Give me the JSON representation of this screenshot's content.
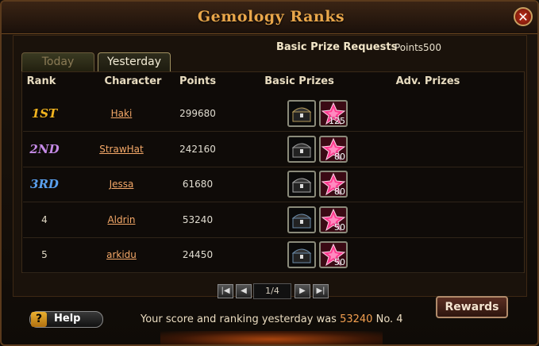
{
  "window": {
    "title": "Gemology Ranks",
    "close_icon": "✕"
  },
  "prize_requests": {
    "label": "Basic Prize Requests",
    "points_text": "Points500"
  },
  "tabs": [
    {
      "label": "Today",
      "active": false
    },
    {
      "label": "Yesterday",
      "active": true
    }
  ],
  "columns": {
    "rank": "Rank",
    "character": "Character",
    "points": "Points",
    "basic_prizes": "Basic Prizes",
    "adv_prizes": "Adv. Prizes"
  },
  "rows": [
    {
      "rank": "1ST",
      "rank_color": "#f3b51f",
      "character": "Haki",
      "points": "299680",
      "chest_color": "#b59a5a",
      "gem_qty": "125"
    },
    {
      "rank": "2ND",
      "rank_color": "#c58ae6",
      "character": "StrawHat",
      "points": "242160",
      "chest_color": "#9a9a9a",
      "gem_qty": "80"
    },
    {
      "rank": "3RD",
      "rank_color": "#5aa0ee",
      "character": "Jessa",
      "points": "61680",
      "chest_color": "#a5a5a5",
      "gem_qty": "80"
    },
    {
      "rank": "4",
      "rank_color": "#e0d8c4",
      "character": "Aldrin",
      "points": "53240",
      "chest_color": "#6a8aa8",
      "gem_qty": "50"
    },
    {
      "rank": "5",
      "rank_color": "#e0d8c4",
      "character": "arkidu",
      "points": "24450",
      "chest_color": "#6a8aa8",
      "gem_qty": "50"
    }
  ],
  "pagination": {
    "indicator": "1/4"
  },
  "help": {
    "icon": "?",
    "label": "Help"
  },
  "score": {
    "prefix": "Your score and ranking yesterday was",
    "value": "53240",
    "rank_text": "No. 4"
  },
  "rewards_button": {
    "label": "Rewards"
  },
  "colors": {
    "accent": "#e8a64a",
    "link": "#f4a868"
  }
}
